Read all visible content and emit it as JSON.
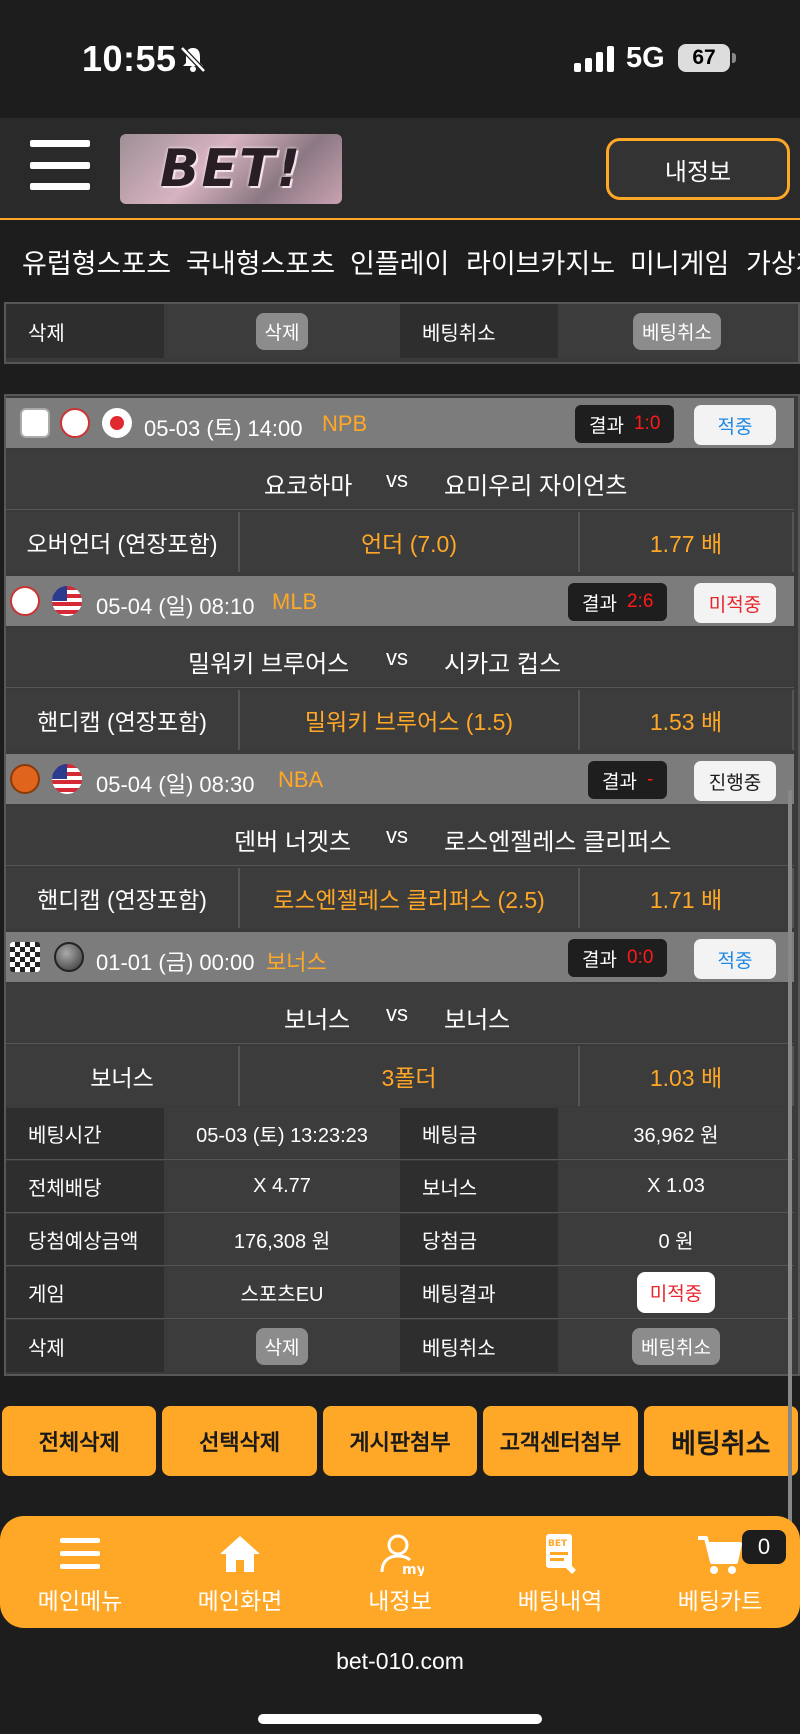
{
  "status_bar": {
    "time": "10:55",
    "network": "5G",
    "battery": "67"
  },
  "header": {
    "logo_text": "BET!",
    "my_info_button": "내정보"
  },
  "nav": [
    "유럽형스포츠",
    "국내형스포츠",
    "인플레이",
    "라이브카지노",
    "미니게임",
    "가상게"
  ],
  "top_section": {
    "delete_label": "삭제",
    "delete_button": "삭제",
    "cancel_label": "베팅취소",
    "cancel_button": "베팅취소"
  },
  "games": [
    {
      "sport_icon": "baseball-icon",
      "flag": "japan-flag-icon",
      "datetime": "05-03 (토) 14:00",
      "league": "NPB",
      "result_label": "결과",
      "score": "1:0",
      "status": "적중",
      "status_color": "#1e88e5",
      "home": "요코하마",
      "vs": "vs",
      "away": "요미우리 자이언츠",
      "bet_type": "오버언더 (연장포함)",
      "pick": "언더 (7.0)",
      "odds": "1.77 배"
    },
    {
      "sport_icon": "baseball-icon",
      "flag": "usa-flag-icon",
      "datetime": "05-04 (일) 08:10",
      "league": "MLB",
      "result_label": "결과",
      "score": "2:6",
      "status": "미적중",
      "status_color": "#e8242d",
      "home": "밀워키 브루어스",
      "vs": "vs",
      "away": "시카고 컵스",
      "bet_type": "핸디캡 (연장포함)",
      "pick": "밀워키 브루어스 (1.5)",
      "odds": "1.53 배"
    },
    {
      "sport_icon": "basketball-icon",
      "flag": "usa-flag-icon",
      "datetime": "05-04 (일) 08:30",
      "league": "NBA",
      "result_label": "결과",
      "score": "-",
      "status": "진행중",
      "status_color": "#1a1a1a",
      "home": "덴버 너겟츠",
      "vs": "vs",
      "away": "로스엔젤레스 클리퍼스",
      "bet_type": "핸디캡 (연장포함)",
      "pick": "로스엔젤레스 클리퍼스 (2.5)",
      "odds": "1.71 배"
    },
    {
      "sport_icon": "bonus-grid-icon",
      "flag": "bonus-ball-icon",
      "datetime": "01-01 (금) 00:00",
      "league": "보너스",
      "result_label": "결과",
      "score": "0:0",
      "status": "적중",
      "status_color": "#1e88e5",
      "home": "보너스",
      "vs": "vs",
      "away": "보너스",
      "bet_type": "보너스",
      "pick": "3폴더",
      "odds": "1.03 배"
    }
  ],
  "summary": [
    {
      "label1": "베팅시간",
      "value1": "05-03 (토) 13:23:23",
      "label2": "베팅금",
      "value2": "36,962 원"
    },
    {
      "label1": "전체배당",
      "value1": "X 4.77",
      "label2": "보너스",
      "value2": "X 1.03"
    },
    {
      "label1": "당첨예상금액",
      "value1": "176,308 원",
      "label2": "당첨금",
      "value2": "0 원"
    },
    {
      "label1": "게임",
      "value1": "스포츠EU",
      "label2": "베팅결과",
      "value2": "미적중"
    },
    {
      "label1": "삭제",
      "value1": "삭제",
      "label2": "베팅취소",
      "value2": "베팅취소"
    }
  ],
  "actions": [
    "전체삭제",
    "선택삭제",
    "게시판첨부",
    "고객센터첨부",
    "베팅취소"
  ],
  "bottom_nav": [
    {
      "label": "메인메뉴",
      "icon": "menu-icon"
    },
    {
      "label": "메인화면",
      "icon": "home-icon"
    },
    {
      "label": "내정보",
      "icon": "user-my-icon"
    },
    {
      "label": "베팅내역",
      "icon": "bet-slip-icon"
    },
    {
      "label": "베팅카트",
      "icon": "cart-icon"
    }
  ],
  "cart_count": "0",
  "url": "bet-010.com"
}
